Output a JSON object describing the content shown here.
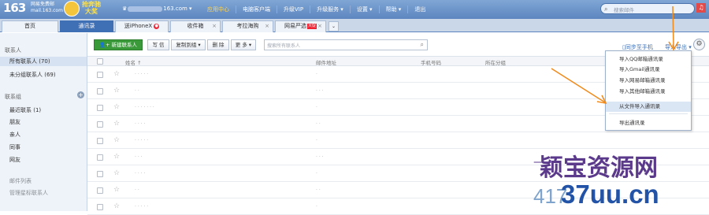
{
  "top": {
    "logo": "163",
    "logo_sub_1": "网易免费邮",
    "logo_sub_2": "mail.163.com",
    "promo_1": "抢奔驰",
    "promo_2": "大奖",
    "user_prefix": "♛",
    "user_suffix": "163.com ▾",
    "nav": [
      "应用中心",
      "电脑客户端",
      "升级VIP",
      "升级服务 ▾",
      "设置 ▾",
      "帮助 ▾",
      "退出"
    ],
    "search_placeholder": "搜索邮件"
  },
  "tabs": [
    {
      "label": "首页"
    },
    {
      "label": "通讯录"
    },
    {
      "label": "送iPhoneX",
      "badge": "●"
    },
    {
      "label": "收件箱",
      "close": "×"
    },
    {
      "label": "考拉海购",
      "close": "×"
    },
    {
      "label": "网易严选",
      "hot": "大促",
      "close": "×"
    }
  ],
  "tab_more": "⌄",
  "sidebar": {
    "header_contacts": "联系人",
    "all_contacts": "所有联系人 (70)",
    "ungrouped": "未分组联系人 (69)",
    "header_groups": "联系组",
    "groups": [
      "最近联系 (1)",
      "朋友",
      "亲人",
      "同事",
      "网友"
    ],
    "mail_list": "邮件列表",
    "manage_star": "管理星标联系人"
  },
  "toolbar": {
    "new_contact": "新建联系人",
    "write": "写 信",
    "copy_group": "复制到组 ▾",
    "delete": "删 除",
    "more": "更 多 ▾",
    "contact_search_placeholder": "搜索所有联系人",
    "sync_phone": "同步至手机",
    "import_export": "导入导出 ▾"
  },
  "table": {
    "columns": [
      "姓名 ↑",
      "邮件地址",
      "手机号码",
      "所在分组"
    ]
  },
  "rows": [
    {
      "name": "· · · · ·",
      "mail": "·"
    },
    {
      "name": "· ·",
      "mail": "· · ·"
    },
    {
      "name": "· · · · · · ·",
      "mail": "·"
    },
    {
      "name": "· · · ·",
      "mail": "· ·"
    },
    {
      "name": "· · · · ·",
      "mail": "·"
    },
    {
      "name": "· · ·",
      "mail": "· · ·"
    },
    {
      "name": "· · · ·",
      "mail": "·"
    },
    {
      "name": "· ·",
      "mail": "· ·"
    },
    {
      "name": "· · · · ·",
      "mail": "·"
    }
  ],
  "dropdown": {
    "items": [
      "导入QQ邮箱通讯录",
      "导入Gmail通讯录",
      "导入网易邮箱通讯录",
      "导入其他邮箱通讯录",
      "从文件导入通讯录",
      "导出通讯录"
    ]
  },
  "watermark": {
    "line1": "颖宝资源网",
    "line2": "37uu.cn",
    "num": "417",
    "dashes": "— —"
  },
  "colors": {
    "header_blue": "#5d86c0",
    "active_tab": "#3f6fb5",
    "new_button_green": "#3a9a3a",
    "annotation_arrow": "#f08a1a"
  }
}
